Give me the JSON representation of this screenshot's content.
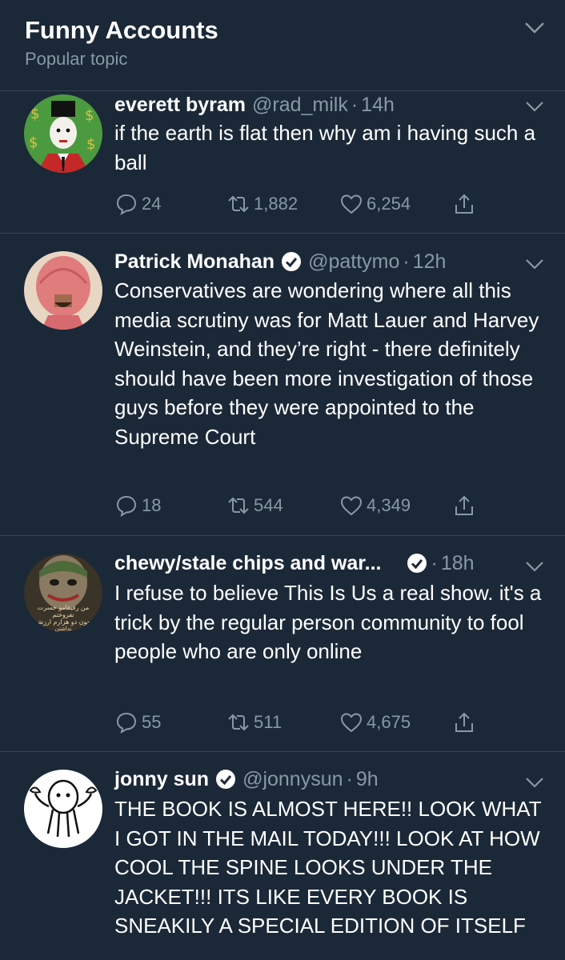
{
  "header": {
    "title": "Funny Accounts",
    "subtitle": "Popular topic"
  },
  "tweets": [
    {
      "name": "everett byram",
      "handle": "@rad_milk",
      "time": "14h",
      "verified": false,
      "text": "if the earth is flat then why am i having such a ball",
      "replies": "24",
      "retweets": "1,882",
      "likes": "6,254"
    },
    {
      "name": "Patrick Monahan",
      "handle": "@pattymo",
      "time": "12h",
      "verified": true,
      "text": "Conservatives are wondering where all this media scrutiny was for Matt Lauer and Harvey Weinstein, and they’re right - there definitely should have been more investigation of those guys before they were appointed to the Supreme Court",
      "replies": "18",
      "retweets": "544",
      "likes": "4,349"
    },
    {
      "name": "chewy/stale chips and war...",
      "handle": "",
      "time": "18h",
      "verified": true,
      "text": "I refuse to believe This Is Us a real show. it's a trick by the regular person community to fool people who are only online",
      "replies": "55",
      "retweets": "511",
      "likes": "4,675",
      "avatar_text": [
        "من رفیقامو حسرت",
        "نفروختم",
        "جون دو هزارم ارزش",
        "نداشتن"
      ]
    },
    {
      "name": "jonny sun",
      "handle": "@jonnysun",
      "time": "9h",
      "verified": true,
      "text": "THE BOOK IS ALMOST HERE!! LOOK WHAT I GOT IN THE MAIL TODAY!!! LOOK AT HOW COOL THE SPINE LOOKS UNDER THE JACKET!!! ITS LIKE EVERY BOOK IS SNEAKILY A SPECIAL EDITION OF ITSELF"
    }
  ],
  "icons": {
    "reply": "reply-icon",
    "retweet": "retweet-icon",
    "like": "like-icon",
    "share": "share-icon",
    "verified": "verified-badge-icon",
    "chevron": "chevron-down-icon"
  },
  "colors": {
    "background": "#1b2837",
    "divider": "#38444d",
    "secondary_text": "#8899a6"
  }
}
